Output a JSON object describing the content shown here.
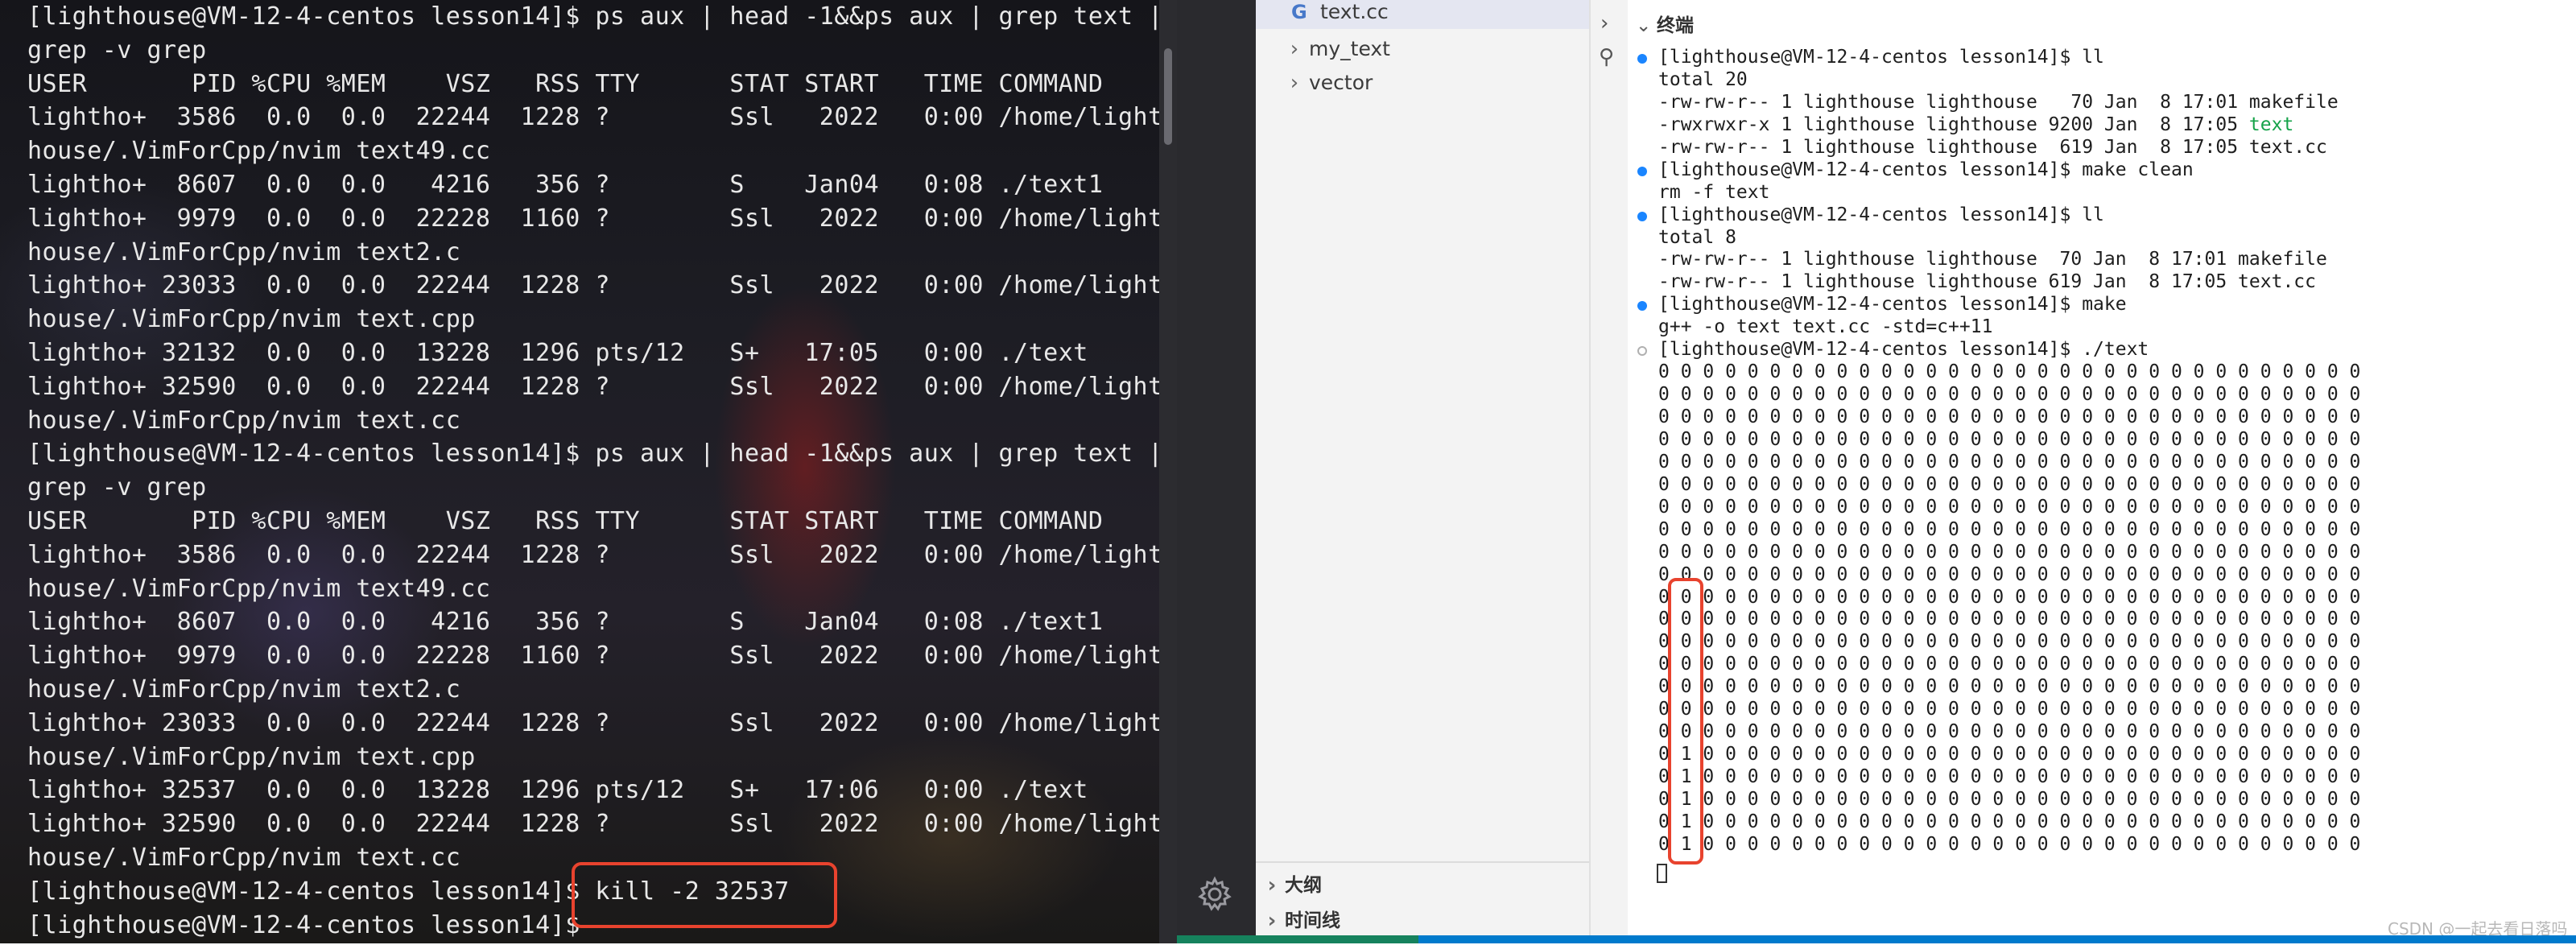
{
  "left_terminal": {
    "lines": [
      "[lighthouse@VM-12-4-centos lesson14]$ ps aux | head -1&&ps aux | grep text |",
      "grep -v grep",
      "USER       PID %CPU %MEM    VSZ   RSS TTY      STAT START   TIME COMMAND",
      "lightho+  3586  0.0  0.0  22244  1228 ?        Ssl   2022   0:00 /home/light",
      "house/.VimForCpp/nvim text49.cc",
      "lightho+  8607  0.0  0.0   4216   356 ?        S    Jan04   0:08 ./text1",
      "lightho+  9979  0.0  0.0  22228  1160 ?        Ssl   2022   0:00 /home/light",
      "house/.VimForCpp/nvim text2.c",
      "lightho+ 23033  0.0  0.0  22244  1228 ?        Ssl   2022   0:00 /home/light",
      "house/.VimForCpp/nvim text.cpp",
      "lightho+ 32132  0.0  0.0  13228  1296 pts/12   S+   17:05   0:00 ./text",
      "lightho+ 32590  0.0  0.0  22244  1228 ?        Ssl   2022   0:00 /home/light",
      "house/.VimForCpp/nvim text.cc",
      "[lighthouse@VM-12-4-centos lesson14]$ ps aux | head -1&&ps aux | grep text |",
      "grep -v grep",
      "USER       PID %CPU %MEM    VSZ   RSS TTY      STAT START   TIME COMMAND",
      "lightho+  3586  0.0  0.0  22244  1228 ?        Ssl   2022   0:00 /home/light",
      "house/.VimForCpp/nvim text49.cc",
      "lightho+  8607  0.0  0.0   4216   356 ?        S    Jan04   0:08 ./text1",
      "lightho+  9979  0.0  0.0  22228  1160 ?        Ssl   2022   0:00 /home/light",
      "house/.VimForCpp/nvim text2.c",
      "lightho+ 23033  0.0  0.0  22244  1228 ?        Ssl   2022   0:00 /home/light",
      "house/.VimForCpp/nvim text.cpp",
      "lightho+ 32537  0.0  0.0  13228  1296 pts/12   S+   17:06   0:00 ./text",
      "lightho+ 32590  0.0  0.0  22244  1228 ?        Ssl   2022   0:00 /home/light",
      "house/.VimForCpp/nvim text.cc",
      "[lighthouse@VM-12-4-centos lesson14]$ kill -2 32537",
      "[lighthouse@VM-12-4-centos lesson14]$ "
    ],
    "highlight_color": "#e8432e"
  },
  "explorer": {
    "file_icon": "G",
    "file_label": "text.cc",
    "folders": [
      {
        "label": "my_text",
        "icon": "chevron-right-icon"
      },
      {
        "label": "vector",
        "icon": "chevron-right-icon"
      }
    ],
    "sections": [
      {
        "label": "大纲"
      },
      {
        "label": "时间线"
      }
    ]
  },
  "terminal_panel": {
    "title": "终端",
    "text_file_color": "#16a34a",
    "lines": [
      {
        "dot": "run",
        "text": "[lighthouse@VM-12-4-centos lesson14]$ ll"
      },
      {
        "dot": "",
        "text": "total 20"
      },
      {
        "dot": "",
        "text": "-rw-rw-r-- 1 lighthouse lighthouse   70 Jan  8 17:01 makefile"
      },
      {
        "dot": "",
        "text": "-rwxrwxr-x 1 lighthouse lighthouse 9200 Jan  8 17:05 ",
        "green": "text"
      },
      {
        "dot": "",
        "text": "-rw-rw-r-- 1 lighthouse lighthouse  619 Jan  8 17:05 text.cc"
      },
      {
        "dot": "run",
        "text": "[lighthouse@VM-12-4-centos lesson14]$ make clean"
      },
      {
        "dot": "",
        "text": "rm -f text"
      },
      {
        "dot": "run",
        "text": "[lighthouse@VM-12-4-centos lesson14]$ ll"
      },
      {
        "dot": "",
        "text": "total 8"
      },
      {
        "dot": "",
        "text": "-rw-rw-r-- 1 lighthouse lighthouse  70 Jan  8 17:01 makefile"
      },
      {
        "dot": "",
        "text": "-rw-rw-r-- 1 lighthouse lighthouse 619 Jan  8 17:05 text.cc"
      },
      {
        "dot": "run",
        "text": "[lighthouse@VM-12-4-centos lesson14]$ make"
      },
      {
        "dot": "",
        "text": "g++ -o text text.cc -std=c++11"
      },
      {
        "dot": "idle",
        "text": "[lighthouse@VM-12-4-centos lesson14]$ ./text"
      },
      {
        "dot": "",
        "text": "0 0 0 0 0 0 0 0 0 0 0 0 0 0 0 0 0 0 0 0 0 0 0 0 0 0 0 0 0 0 0 0"
      },
      {
        "dot": "",
        "text": "0 0 0 0 0 0 0 0 0 0 0 0 0 0 0 0 0 0 0 0 0 0 0 0 0 0 0 0 0 0 0 0"
      },
      {
        "dot": "",
        "text": "0 0 0 0 0 0 0 0 0 0 0 0 0 0 0 0 0 0 0 0 0 0 0 0 0 0 0 0 0 0 0 0"
      },
      {
        "dot": "",
        "text": "0 0 0 0 0 0 0 0 0 0 0 0 0 0 0 0 0 0 0 0 0 0 0 0 0 0 0 0 0 0 0 0"
      },
      {
        "dot": "",
        "text": "0 0 0 0 0 0 0 0 0 0 0 0 0 0 0 0 0 0 0 0 0 0 0 0 0 0 0 0 0 0 0 0"
      },
      {
        "dot": "",
        "text": "0 0 0 0 0 0 0 0 0 0 0 0 0 0 0 0 0 0 0 0 0 0 0 0 0 0 0 0 0 0 0 0"
      },
      {
        "dot": "",
        "text": "0 0 0 0 0 0 0 0 0 0 0 0 0 0 0 0 0 0 0 0 0 0 0 0 0 0 0 0 0 0 0 0"
      },
      {
        "dot": "",
        "text": "0 0 0 0 0 0 0 0 0 0 0 0 0 0 0 0 0 0 0 0 0 0 0 0 0 0 0 0 0 0 0 0"
      },
      {
        "dot": "",
        "text": "0 0 0 0 0 0 0 0 0 0 0 0 0 0 0 0 0 0 0 0 0 0 0 0 0 0 0 0 0 0 0 0"
      },
      {
        "dot": "",
        "text": "0 0 0 0 0 0 0 0 0 0 0 0 0 0 0 0 0 0 0 0 0 0 0 0 0 0 0 0 0 0 0 0"
      },
      {
        "dot": "",
        "text": "0 0 0 0 0 0 0 0 0 0 0 0 0 0 0 0 0 0 0 0 0 0 0 0 0 0 0 0 0 0 0 0"
      },
      {
        "dot": "",
        "text": "0 0 0 0 0 0 0 0 0 0 0 0 0 0 0 0 0 0 0 0 0 0 0 0 0 0 0 0 0 0 0 0"
      },
      {
        "dot": "",
        "text": "0 0 0 0 0 0 0 0 0 0 0 0 0 0 0 0 0 0 0 0 0 0 0 0 0 0 0 0 0 0 0 0"
      },
      {
        "dot": "",
        "text": "0 0 0 0 0 0 0 0 0 0 0 0 0 0 0 0 0 0 0 0 0 0 0 0 0 0 0 0 0 0 0 0"
      },
      {
        "dot": "",
        "text": "0 0 0 0 0 0 0 0 0 0 0 0 0 0 0 0 0 0 0 0 0 0 0 0 0 0 0 0 0 0 0 0"
      },
      {
        "dot": "",
        "text": "0 0 0 0 0 0 0 0 0 0 0 0 0 0 0 0 0 0 0 0 0 0 0 0 0 0 0 0 0 0 0 0"
      },
      {
        "dot": "",
        "text": "0 0 0 0 0 0 0 0 0 0 0 0 0 0 0 0 0 0 0 0 0 0 0 0 0 0 0 0 0 0 0 0"
      },
      {
        "dot": "",
        "text": "0 1 0 0 0 0 0 0 0 0 0 0 0 0 0 0 0 0 0 0 0 0 0 0 0 0 0 0 0 0 0 0"
      },
      {
        "dot": "",
        "text": "0 1 0 0 0 0 0 0 0 0 0 0 0 0 0 0 0 0 0 0 0 0 0 0 0 0 0 0 0 0 0 0"
      },
      {
        "dot": "",
        "text": "0 1 0 0 0 0 0 0 0 0 0 0 0 0 0 0 0 0 0 0 0 0 0 0 0 0 0 0 0 0 0 0"
      },
      {
        "dot": "",
        "text": "0 1 0 0 0 0 0 0 0 0 0 0 0 0 0 0 0 0 0 0 0 0 0 0 0 0 0 0 0 0 0 0"
      },
      {
        "dot": "",
        "text": "0 1 0 0 0 0 0 0 0 0 0 0 0 0 0 0 0 0 0 0 0 0 0 0 0 0 0 0 0 0 0 0"
      }
    ],
    "highlight_color": "#e8432e"
  },
  "watermark": "CSDN @一起去看日落吗",
  "colors": {
    "status_bar": "#007acc",
    "explorer_bg": "#f3f3f3",
    "run_dot": "#1a85ff"
  }
}
